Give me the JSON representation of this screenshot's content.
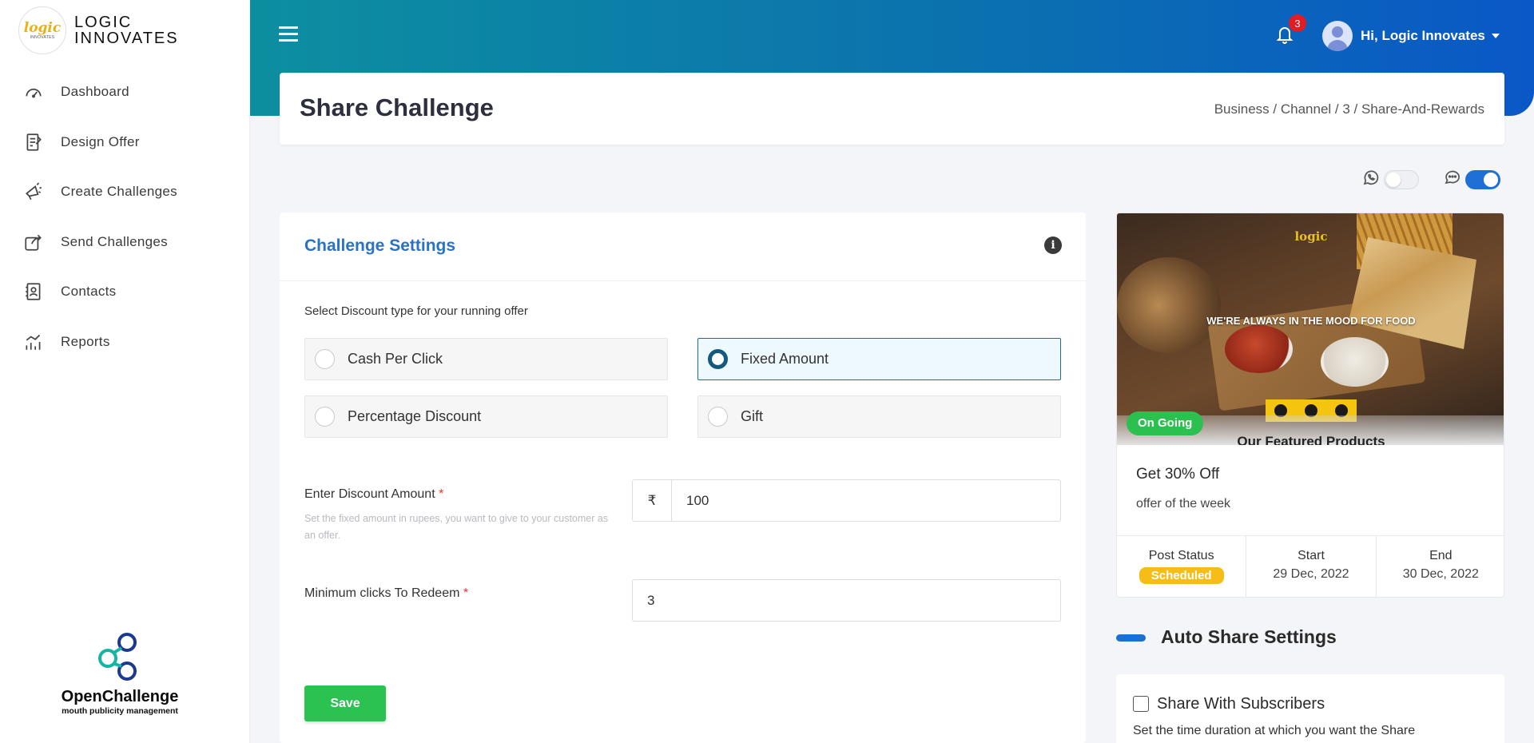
{
  "brand": {
    "logo_text": "logic",
    "logo_subtext": "INNOVATES",
    "name_line1": "LOGIC",
    "name_line2": "INNOVATES"
  },
  "sidebar": {
    "items": [
      {
        "label": "Dashboard",
        "icon": "speedometer-icon"
      },
      {
        "label": "Design Offer",
        "icon": "design-offer-icon"
      },
      {
        "label": "Create Challenges",
        "icon": "megaphone-icon"
      },
      {
        "label": "Send Challenges",
        "icon": "share-icon"
      },
      {
        "label": "Contacts",
        "icon": "contacts-icon"
      },
      {
        "label": "Reports",
        "icon": "reports-icon"
      }
    ],
    "footer_brand": "OpenChallenge",
    "footer_tagline": "mouth publicity management"
  },
  "header": {
    "notification_count": "3",
    "user_greeting": "Hi, Logic Innovates"
  },
  "page": {
    "title": "Share Challenge",
    "breadcrumb": "Business / Channel / 3 / Share-And-Rewards"
  },
  "toggles": {
    "whatsapp_enabled": false,
    "sms_enabled": true
  },
  "settings": {
    "title": "Challenge Settings",
    "discount_type_label": "Select Discount type for your running offer",
    "options": [
      {
        "label": "Cash Per Click",
        "selected": false
      },
      {
        "label": "Fixed Amount",
        "selected": true
      },
      {
        "label": "Percentage Discount",
        "selected": false
      },
      {
        "label": "Gift",
        "selected": false
      }
    ],
    "amount_label": "Enter Discount Amount",
    "required_mark": "*",
    "amount_help": "Set the fixed amount in rupees, you want to give to your customer as an offer.",
    "currency_symbol": "₹",
    "amount_value": "100",
    "min_clicks_label": "Minimum clicks To Redeem",
    "min_clicks_value": "3",
    "save_label": "Save"
  },
  "offer": {
    "image_logo": "logic",
    "image_headline": "WE'RE ALWAYS IN THE MOOD FOR FOOD",
    "image_featured": "Our Featured Products",
    "status_pill": "On Going",
    "title": "Get 30% Off",
    "subtitle": "offer of the week",
    "meta": {
      "post_status_label": "Post Status",
      "post_status_value": "Scheduled",
      "start_label": "Start",
      "start_value": "29 Dec, 2022",
      "end_label": "End",
      "end_value": "30 Dec, 2022"
    }
  },
  "auto_share": {
    "title": "Auto Share Settings",
    "checkbox_label": "Share With Subscribers",
    "description": "Set the time duration at which you want the Share"
  },
  "colors": {
    "accent_blue": "#2a72c4",
    "success_green": "#2bc252",
    "scheduled_yellow": "#f6bd16",
    "badge_red": "#e31b23"
  }
}
